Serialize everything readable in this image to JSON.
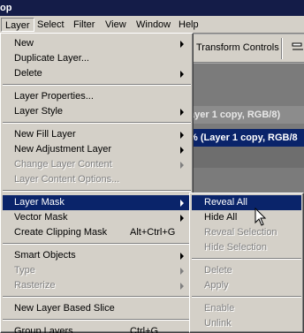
{
  "window": {
    "title": "op"
  },
  "menubar": [
    {
      "label": "Layer",
      "active": true
    },
    {
      "label": "Select"
    },
    {
      "label": "Filter"
    },
    {
      "label": "View"
    },
    {
      "label": "Window"
    },
    {
      "label": "Help"
    }
  ],
  "options": {
    "transform_label": "Transform Controls"
  },
  "documents": [
    {
      "title": "ayer 1 copy, RGB/8)"
    },
    {
      "title": "% (Layer 1 copy, RGB/8"
    }
  ],
  "layer_menu": {
    "items": [
      {
        "label": "New",
        "submenu": true
      },
      {
        "label": "Duplicate Layer..."
      },
      {
        "label": "Delete",
        "submenu": true
      },
      {
        "label": "Layer Properties..."
      },
      {
        "label": "Layer Style",
        "submenu": true
      },
      {
        "label": "New Fill Layer",
        "submenu": true
      },
      {
        "label": "New Adjustment Layer",
        "submenu": true
      },
      {
        "label": "Change Layer Content",
        "submenu": true,
        "disabled": true
      },
      {
        "label": "Layer Content Options...",
        "disabled": true
      },
      {
        "label": "Layer Mask",
        "submenu": true,
        "highlighted": true
      },
      {
        "label": "Vector Mask",
        "submenu": true
      },
      {
        "label": "Create Clipping Mask",
        "shortcut": "Alt+Ctrl+G"
      },
      {
        "label": "Smart Objects",
        "submenu": true
      },
      {
        "label": "Type",
        "submenu": true,
        "disabled": true
      },
      {
        "label": "Rasterize",
        "submenu": true,
        "disabled": true
      },
      {
        "label": "New Layer Based Slice"
      },
      {
        "label": "Group Layers",
        "shortcut": "Ctrl+G"
      }
    ]
  },
  "layer_mask_submenu": {
    "items": [
      {
        "label": "Reveal All",
        "highlighted": true
      },
      {
        "label": "Hide All"
      },
      {
        "label": "Reveal Selection",
        "disabled": true
      },
      {
        "label": "Hide Selection",
        "disabled": true
      },
      {
        "label": "Delete",
        "disabled": true
      },
      {
        "label": "Apply",
        "disabled": true
      },
      {
        "label": "Enable",
        "disabled": true
      },
      {
        "label": "Unlink",
        "disabled": true
      }
    ]
  },
  "colors": {
    "highlight": "#0a246a",
    "menu_bg": "#d4d0c8",
    "disabled_text": "#808080"
  }
}
